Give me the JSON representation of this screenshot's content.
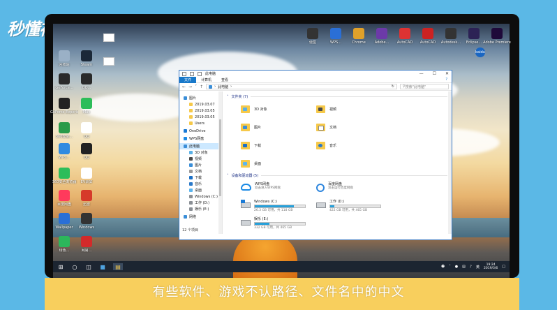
{
  "brand": "秒懂视频",
  "subtitle": "有些软件、游戏不认路径、文件名中的中文",
  "desktop_icons_left": [
    {
      "label": "回收站",
      "color": "#9ab0c6"
    },
    {
      "label": "Steam",
      "color": "#1b2838"
    },
    {
      "label": "GeForce...",
      "color": "#2a2a2a"
    },
    {
      "label": "QQ...",
      "color": "#2a2a2a"
    },
    {
      "label": "GeForce Experience",
      "color": "#222"
    },
    {
      "label": "Max",
      "color": "#2dbd5a"
    },
    {
      "label": "360安全...",
      "color": "#2a9b49"
    },
    {
      "label": "QQ",
      "color": "#ffffff"
    },
    {
      "label": "WPS...",
      "color": "#2f8ae0"
    },
    {
      "label": "QQ",
      "color": "#222"
    },
    {
      "label": "360安全浏览器",
      "color": "#2dbd5a"
    },
    {
      "label": "EV录屏",
      "color": "#ffffff"
    },
    {
      "label": "百度网盘",
      "color": "#ff3a5c"
    },
    {
      "label": "迅雷",
      "color": "#d63a2a"
    },
    {
      "label": "Wallpaper",
      "color": "#2a6fd6"
    },
    {
      "label": "Windows",
      "color": "#333"
    },
    {
      "label": "绿色...",
      "color": "#2cb75b"
    },
    {
      "label": "网易...",
      "color": "#d32a2a"
    }
  ],
  "desktop_icons_top": [
    {
      "label": "便签",
      "color": "#333"
    },
    {
      "label": "WPS...",
      "color": "#2a6fd6"
    },
    {
      "label": "Chrome",
      "color": "#e0a12a"
    },
    {
      "label": "Adobe...",
      "color": "#6c3aa8"
    },
    {
      "label": "AutoCAD",
      "color": "#d33"
    },
    {
      "label": "AutoCAD",
      "color": "#c22"
    },
    {
      "label": "Autodesk...",
      "color": "#333"
    },
    {
      "label": "Eclipse...",
      "color": "#2c2255"
    },
    {
      "label": "Adobe Premiere",
      "color": "#1f0a3a"
    }
  ],
  "avatar": "baidu",
  "explorer": {
    "title": "此电脑",
    "tabs": [
      "文件",
      "计算机",
      "查看"
    ],
    "address": "此电脑",
    "search_placeholder": "搜索\"此电脑\"",
    "nav_items": [
      {
        "label": "图片",
        "kind": "top",
        "color": "#3a8ed8"
      },
      {
        "label": "2019.03.07",
        "kind": "sub",
        "color": "#f6c94a"
      },
      {
        "label": "2019.03.05",
        "kind": "sub",
        "color": "#f6c94a"
      },
      {
        "label": "2019.03.05",
        "kind": "sub",
        "color": "#f6c94a"
      },
      {
        "label": "Users",
        "kind": "sub",
        "color": "#f6c94a"
      },
      {
        "label": "OneDrive",
        "kind": "top",
        "color": "#1a7ad6"
      },
      {
        "label": "WPS网盘",
        "kind": "top",
        "color": "#1a8ae5"
      },
      {
        "label": "此电脑",
        "kind": "top",
        "color": "#3a8ed8",
        "selected": true
      },
      {
        "label": "3D 对象",
        "kind": "sub",
        "color": "#5ab0e6"
      },
      {
        "label": "视频",
        "kind": "sub",
        "color": "#4a4a4a"
      },
      {
        "label": "图片",
        "kind": "sub",
        "color": "#3a8ed8"
      },
      {
        "label": "文档",
        "kind": "sub",
        "color": "#999"
      },
      {
        "label": "下载",
        "kind": "sub",
        "color": "#1a6fc6"
      },
      {
        "label": "音乐",
        "kind": "sub",
        "color": "#2b79c9"
      },
      {
        "label": "桌面",
        "kind": "sub",
        "color": "#5cb5ef"
      },
      {
        "label": "Windows (C:)",
        "kind": "sub",
        "color": "#8a8f95"
      },
      {
        "label": "工作 (D:)",
        "kind": "sub",
        "color": "#8a8f95"
      },
      {
        "label": "娱乐 (E:)",
        "kind": "sub",
        "color": "#8a8f95"
      },
      {
        "label": "网络",
        "kind": "top",
        "color": "#3a8ed8"
      }
    ],
    "folders_header": "文件夹 (7)",
    "folders": [
      {
        "label": "3D 对象",
        "icon": "i3d"
      },
      {
        "label": "视频",
        "icon": "ivid"
      },
      {
        "label": "图片",
        "icon": "ipic"
      },
      {
        "label": "文档",
        "icon": "idoc"
      },
      {
        "label": "下载",
        "icon": "idl"
      },
      {
        "label": "音乐",
        "icon": "imus"
      },
      {
        "label": "桌面",
        "icon": "idesk"
      }
    ],
    "drives_header": "设备和驱动器 (5)",
    "drives": [
      {
        "name": "WPS网盘",
        "sub": "双击进入WPS网盘",
        "type": "cloud",
        "fill": null
      },
      {
        "name": "百度网盘",
        "sub": "双击运行百度网盘",
        "type": "baidu",
        "fill": null
      },
      {
        "name": "Windows (C:)",
        "sub": "26.3 GB 可用，共 118 GB",
        "type": "win",
        "fill": 0.78
      },
      {
        "name": "工作 (D:)",
        "sub": "422 GB 可用，共 465 GB",
        "type": "disk",
        "fill": 0.09
      },
      {
        "name": "娱乐 (E:)",
        "sub": "332 GB 可用，共 465 GB",
        "type": "disk",
        "fill": 0.29
      }
    ],
    "status": "12 个项目"
  },
  "taskbar": {
    "tray_lang": "英",
    "time": "19:24",
    "date": "2019/3/6"
  }
}
